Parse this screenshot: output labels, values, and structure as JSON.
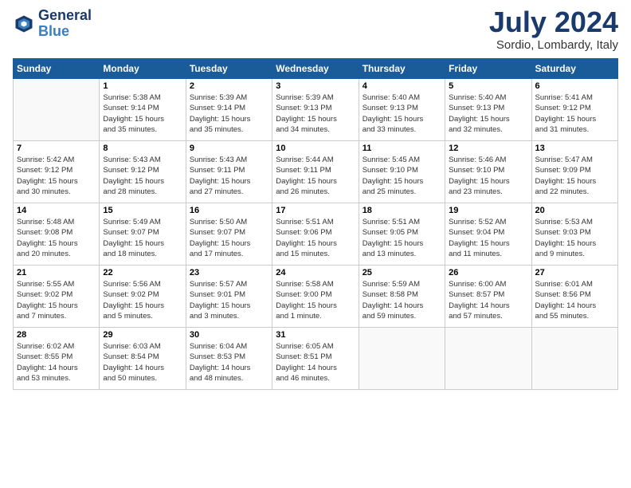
{
  "header": {
    "logo_line1": "General",
    "logo_line2": "Blue",
    "month": "July 2024",
    "location": "Sordio, Lombardy, Italy"
  },
  "days_of_week": [
    "Sunday",
    "Monday",
    "Tuesday",
    "Wednesday",
    "Thursday",
    "Friday",
    "Saturday"
  ],
  "weeks": [
    [
      {
        "num": "",
        "info": ""
      },
      {
        "num": "1",
        "info": "Sunrise: 5:38 AM\nSunset: 9:14 PM\nDaylight: 15 hours\nand 35 minutes."
      },
      {
        "num": "2",
        "info": "Sunrise: 5:39 AM\nSunset: 9:14 PM\nDaylight: 15 hours\nand 35 minutes."
      },
      {
        "num": "3",
        "info": "Sunrise: 5:39 AM\nSunset: 9:13 PM\nDaylight: 15 hours\nand 34 minutes."
      },
      {
        "num": "4",
        "info": "Sunrise: 5:40 AM\nSunset: 9:13 PM\nDaylight: 15 hours\nand 33 minutes."
      },
      {
        "num": "5",
        "info": "Sunrise: 5:40 AM\nSunset: 9:13 PM\nDaylight: 15 hours\nand 32 minutes."
      },
      {
        "num": "6",
        "info": "Sunrise: 5:41 AM\nSunset: 9:12 PM\nDaylight: 15 hours\nand 31 minutes."
      }
    ],
    [
      {
        "num": "7",
        "info": "Sunrise: 5:42 AM\nSunset: 9:12 PM\nDaylight: 15 hours\nand 30 minutes."
      },
      {
        "num": "8",
        "info": "Sunrise: 5:43 AM\nSunset: 9:12 PM\nDaylight: 15 hours\nand 28 minutes."
      },
      {
        "num": "9",
        "info": "Sunrise: 5:43 AM\nSunset: 9:11 PM\nDaylight: 15 hours\nand 27 minutes."
      },
      {
        "num": "10",
        "info": "Sunrise: 5:44 AM\nSunset: 9:11 PM\nDaylight: 15 hours\nand 26 minutes."
      },
      {
        "num": "11",
        "info": "Sunrise: 5:45 AM\nSunset: 9:10 PM\nDaylight: 15 hours\nand 25 minutes."
      },
      {
        "num": "12",
        "info": "Sunrise: 5:46 AM\nSunset: 9:10 PM\nDaylight: 15 hours\nand 23 minutes."
      },
      {
        "num": "13",
        "info": "Sunrise: 5:47 AM\nSunset: 9:09 PM\nDaylight: 15 hours\nand 22 minutes."
      }
    ],
    [
      {
        "num": "14",
        "info": "Sunrise: 5:48 AM\nSunset: 9:08 PM\nDaylight: 15 hours\nand 20 minutes."
      },
      {
        "num": "15",
        "info": "Sunrise: 5:49 AM\nSunset: 9:07 PM\nDaylight: 15 hours\nand 18 minutes."
      },
      {
        "num": "16",
        "info": "Sunrise: 5:50 AM\nSunset: 9:07 PM\nDaylight: 15 hours\nand 17 minutes."
      },
      {
        "num": "17",
        "info": "Sunrise: 5:51 AM\nSunset: 9:06 PM\nDaylight: 15 hours\nand 15 minutes."
      },
      {
        "num": "18",
        "info": "Sunrise: 5:51 AM\nSunset: 9:05 PM\nDaylight: 15 hours\nand 13 minutes."
      },
      {
        "num": "19",
        "info": "Sunrise: 5:52 AM\nSunset: 9:04 PM\nDaylight: 15 hours\nand 11 minutes."
      },
      {
        "num": "20",
        "info": "Sunrise: 5:53 AM\nSunset: 9:03 PM\nDaylight: 15 hours\nand 9 minutes."
      }
    ],
    [
      {
        "num": "21",
        "info": "Sunrise: 5:55 AM\nSunset: 9:02 PM\nDaylight: 15 hours\nand 7 minutes."
      },
      {
        "num": "22",
        "info": "Sunrise: 5:56 AM\nSunset: 9:02 PM\nDaylight: 15 hours\nand 5 minutes."
      },
      {
        "num": "23",
        "info": "Sunrise: 5:57 AM\nSunset: 9:01 PM\nDaylight: 15 hours\nand 3 minutes."
      },
      {
        "num": "24",
        "info": "Sunrise: 5:58 AM\nSunset: 9:00 PM\nDaylight: 15 hours\nand 1 minute."
      },
      {
        "num": "25",
        "info": "Sunrise: 5:59 AM\nSunset: 8:58 PM\nDaylight: 14 hours\nand 59 minutes."
      },
      {
        "num": "26",
        "info": "Sunrise: 6:00 AM\nSunset: 8:57 PM\nDaylight: 14 hours\nand 57 minutes."
      },
      {
        "num": "27",
        "info": "Sunrise: 6:01 AM\nSunset: 8:56 PM\nDaylight: 14 hours\nand 55 minutes."
      }
    ],
    [
      {
        "num": "28",
        "info": "Sunrise: 6:02 AM\nSunset: 8:55 PM\nDaylight: 14 hours\nand 53 minutes."
      },
      {
        "num": "29",
        "info": "Sunrise: 6:03 AM\nSunset: 8:54 PM\nDaylight: 14 hours\nand 50 minutes."
      },
      {
        "num": "30",
        "info": "Sunrise: 6:04 AM\nSunset: 8:53 PM\nDaylight: 14 hours\nand 48 minutes."
      },
      {
        "num": "31",
        "info": "Sunrise: 6:05 AM\nSunset: 8:51 PM\nDaylight: 14 hours\nand 46 minutes."
      },
      {
        "num": "",
        "info": ""
      },
      {
        "num": "",
        "info": ""
      },
      {
        "num": "",
        "info": ""
      }
    ]
  ]
}
